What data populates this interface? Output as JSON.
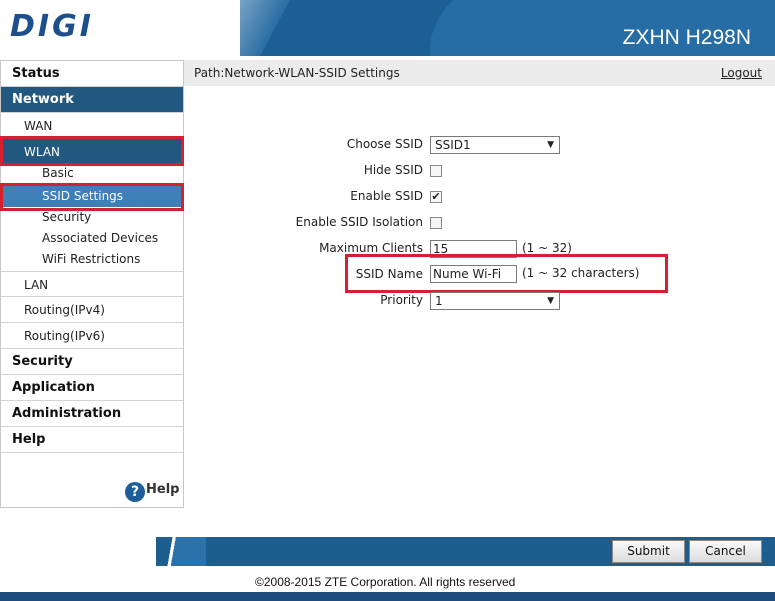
{
  "header": {
    "logo_text": "DIGI",
    "model": "ZXHN H298N"
  },
  "path": {
    "text": "Path:Network-WLAN-SSID Settings",
    "logout_label": "Logout"
  },
  "sidebar": {
    "status": "Status",
    "network": "Network",
    "wan": "WAN",
    "wlan": "WLAN",
    "basic": "Basic",
    "ssid_settings": "SSID Settings",
    "security_sub": "Security",
    "associated_devices": "Associated Devices",
    "wifi_restrictions": "WiFi Restrictions",
    "lan": "LAN",
    "routing_ipv4": "Routing(IPv4)",
    "routing_ipv6": "Routing(IPv6)",
    "security": "Security",
    "application": "Application",
    "administration": "Administration",
    "help": "Help",
    "help_icon": "?"
  },
  "form": {
    "choose_ssid_label": "Choose SSID",
    "choose_ssid_value": "SSID1",
    "hide_ssid_label": "Hide SSID",
    "hide_ssid_checked": false,
    "enable_ssid_label": "Enable SSID",
    "enable_ssid_checked": true,
    "enable_isolation_label": "Enable SSID Isolation",
    "enable_isolation_checked": false,
    "max_clients_label": "Maximum Clients",
    "max_clients_value": "15",
    "max_clients_hint": "(1 ~ 32)",
    "ssid_name_label": "SSID Name",
    "ssid_name_value": "Nume Wi-Fi",
    "ssid_name_hint": "(1 ~ 32 characters)",
    "priority_label": "Priority",
    "priority_value": "1",
    "check_mark": "✔",
    "arrow": "▼"
  },
  "buttons": {
    "submit": "Submit",
    "cancel": "Cancel"
  },
  "footer": {
    "copyright": "©2008-2015 ZTE Corporation. All rights reserved"
  },
  "colors": {
    "brand_blue": "#1b5f95",
    "highlight_red": "#d6202f",
    "menu_active": "#22577f"
  }
}
